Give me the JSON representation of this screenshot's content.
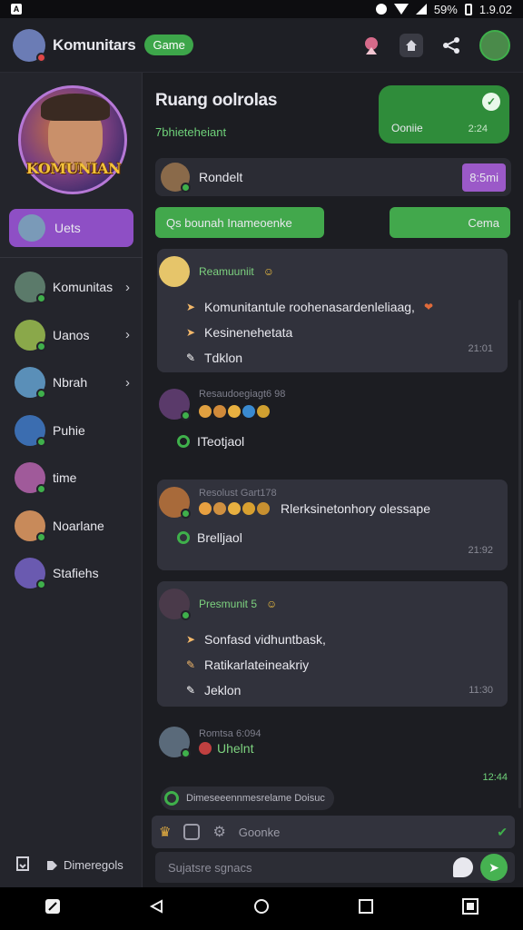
{
  "status_bar": {
    "time": "1.9.02",
    "battery": "59%"
  },
  "header": {
    "title": "Komunitars",
    "game_chip": "Game"
  },
  "sidebar": {
    "hero_label": "KOMUNIAN",
    "active_item": "Uets",
    "items": [
      {
        "label": "Komunitas",
        "chevron": true,
        "avatar_color": "#5b7a6a",
        "status": "#3fb04b"
      },
      {
        "label": "Uanos",
        "chevron": true,
        "avatar_color": "#8aa84a",
        "status": "#3fb04b"
      },
      {
        "label": "Nbrah",
        "chevron": true,
        "avatar_color": "#5a8fb8",
        "status": "#3fb04b"
      },
      {
        "label": "Puhie",
        "chevron": false,
        "avatar_color": "#3b6db0",
        "status": "#3fb04b"
      },
      {
        "label": "time",
        "chevron": false,
        "avatar_color": "#a05a9a",
        "status": "#3fb04b"
      },
      {
        "label": "Noarlane",
        "chevron": false,
        "avatar_color": "#c88a5a",
        "status": "#3fb04b"
      },
      {
        "label": "Stafiehs",
        "chevron": false,
        "avatar_color": "#6a5ab0",
        "status": "#3fb04b"
      }
    ],
    "bottom_label": "Dimeregols"
  },
  "main": {
    "room_title": "Ruang oolrolas",
    "room_subtitle": "7bhieteheiant",
    "online_card": {
      "label": "Ooniie",
      "time": "2:24"
    },
    "pinned": {
      "name": "Rondelt",
      "badge": "8:5mi"
    },
    "buttons": {
      "left": "Qs  bounah  Inameoenke",
      "right": "Cema"
    },
    "messages": [
      {
        "name": "Reamuuniit",
        "time": "21:01",
        "lines": [
          "Komunitantule roohenasardenleliaag,",
          "Kesinenehetata",
          "Tdklon"
        ]
      },
      {
        "name": "Resaudoegiagt6 98",
        "reaction": "ITeotjaol"
      },
      {
        "name": "Resolust Gart178",
        "text": "Rlerksinetonhory olessape",
        "reaction": "Brelljaol",
        "time": "21:92"
      },
      {
        "name": "Presmunit 5",
        "time": "11:30",
        "lines": [
          "Sonfasd vidhuntbask,",
          "Ratikarlateineakriy",
          "Jeklon"
        ]
      },
      {
        "name": "Romtsa 6:094",
        "text": "Uhelnt",
        "time": "12:44"
      }
    ],
    "system_pill": "Dimeseeennmesrelame Doisuc",
    "composer_top_text": "Goonke",
    "composer_placeholder": "Sujatsre sgnacs"
  }
}
